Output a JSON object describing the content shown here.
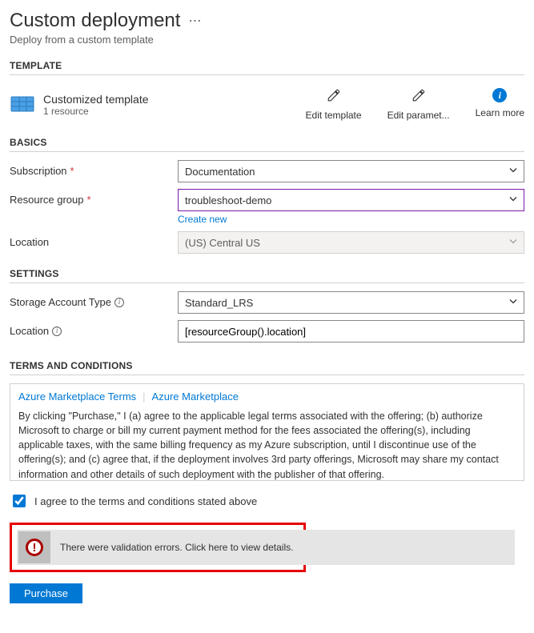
{
  "header": {
    "title": "Custom deployment",
    "subtitle": "Deploy from a custom template"
  },
  "template": {
    "heading": "TEMPLATE",
    "name": "Customized template",
    "resource_count": "1 resource",
    "actions": {
      "edit_template": "Edit template",
      "edit_parameters": "Edit paramet...",
      "learn_more": "Learn more"
    }
  },
  "basics": {
    "heading": "BASICS",
    "subscription": {
      "label": "Subscription",
      "value": "Documentation"
    },
    "resource_group": {
      "label": "Resource group",
      "value": "troubleshoot-demo",
      "create_new": "Create new"
    },
    "location": {
      "label": "Location",
      "value": "(US) Central US"
    }
  },
  "settings": {
    "heading": "SETTINGS",
    "storage_account_type": {
      "label": "Storage Account Type",
      "value": "Standard_LRS"
    },
    "location": {
      "label": "Location",
      "value": "[resourceGroup().location]"
    }
  },
  "terms": {
    "heading": "TERMS AND CONDITIONS",
    "link1": "Azure Marketplace Terms",
    "link2": "Azure Marketplace",
    "body": "By clicking \"Purchase,\" I (a) agree to the applicable legal terms associated with the offering; (b) authorize Microsoft to charge or bill my current payment method for the fees associated the offering(s), including applicable taxes, with the same billing frequency as my Azure subscription, until I discontinue use of the offering(s); and (c) agree that, if the deployment involves 3rd party offerings, Microsoft may share my contact information and other details of such deployment with the publisher of that offering.",
    "agree_label": "I agree to the terms and conditions stated above"
  },
  "validation": {
    "message": "There were validation errors. Click here to view details."
  },
  "footer": {
    "purchase": "Purchase"
  }
}
